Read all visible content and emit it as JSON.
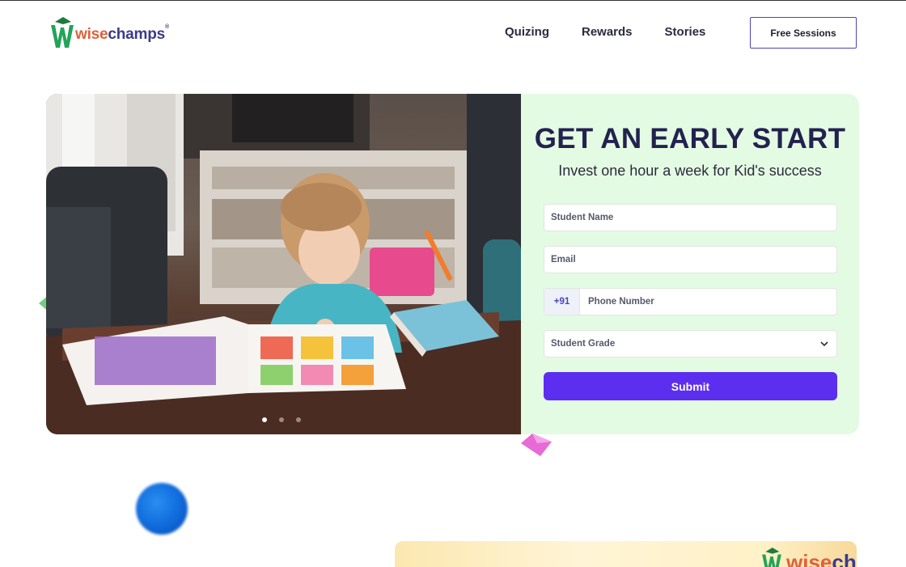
{
  "brand": {
    "part1": "wise",
    "part2": "champs",
    "reg": "®",
    "color_w": "#22a45a",
    "color_wise": "#e0603a",
    "color_champs": "#3b3a8c"
  },
  "nav": {
    "items": [
      "Quizing",
      "Rewards",
      "Stories"
    ],
    "cta_label": "Free Sessions"
  },
  "hero": {
    "title": "GET AN EARLY START",
    "subtitle": "Invest one hour a week for Kid's success",
    "form": {
      "student_name_placeholder": "Student Name",
      "email_placeholder": "Email",
      "country_code": "+91",
      "phone_placeholder": "Phone Number",
      "grade_selected": "Student Grade",
      "submit_label": "Submit"
    },
    "carousel": {
      "slide_count": 3,
      "active_index": 0
    },
    "accent_color": "#5b2ef0",
    "panel_color": "#e4fbe3"
  },
  "bottom_card": {
    "logo_part1": "wise",
    "logo_part2": "char"
  }
}
